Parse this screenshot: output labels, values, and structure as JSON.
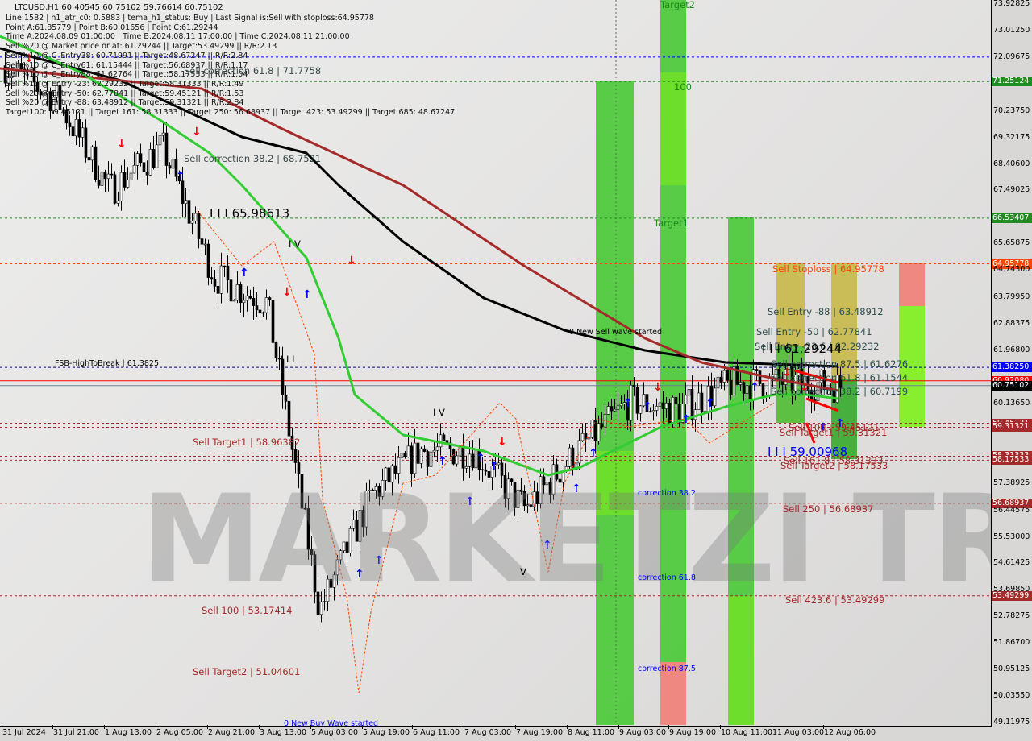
{
  "header": {
    "title": "LTCUSD,H1  60.40545 60.75102 59.76614 60.75102",
    "lines": [
      "Line:1582 | h1_atr_c0: 0.5883 | tema_h1_status: Buy | Last Signal is:Sell with stoploss:64.95778",
      "Point A:61.85779 | Point B:60.01656 | Point C:61.29244",
      "Time A:2024.08.09 01:00:00 | Time B:2024.08.11 17:00:00 | Time C:2024.08.11 21:00:00",
      "Sell %20 @ Market price or at: 61.29244 || Target:53.49299 || R/R:2.13",
      "Sell %10 @ C_Entry38: 60.71991 || Target:48.67247 || R/R:2.84",
      "Sell %10 @ C_Entry61: 61.15444 || Target:56.68937 || R/R:1.17",
      "Sell %10 @ C_Entry88: 61.62764 || Target:58.17533 || R/R:1.04",
      "Sell %10 @ Entry -23: 62.29232 || Target:58.31333 || R/R:1.49",
      "Sell %20 @ Entry -50: 62.77841 || Target:59.45121 || R/R:1.53",
      "Sell %20 @ Entry -88: 63.48912 || Target:59.31321 || R/R:2.84",
      "Target100: 59.45121 || Target 161: 58.31333 || Target 250: 56.68937 || Target 423: 53.49299 || Target 685: 48.67247"
    ]
  },
  "watermark": "MARKETZ TRADE",
  "annotations": [
    {
      "text": "Sell correction 61.8 | 71.7758",
      "color": "#3a4a4a"
    },
    {
      "text": "Sell correction 38.2 | 68.7521",
      "color": "#3a4a4a"
    },
    {
      "text": "I I I 65.98613",
      "color": "#000000"
    },
    {
      "text": "I V",
      "color": "#000000"
    },
    {
      "text": "I I I",
      "color": "#000000"
    },
    {
      "text": "FSB-HighToBreak | 61.3825",
      "color": "#000000"
    },
    {
      "text": "Sell Target1 | 58.96382",
      "color": "#a52a2a"
    },
    {
      "text": "I V",
      "color": "#000000"
    },
    {
      "text": "V",
      "color": "#000000"
    },
    {
      "text": "Sell 100 | 53.17414",
      "color": "#a52a2a"
    },
    {
      "text": "Sell Target2 | 51.04601",
      "color": "#a52a2a"
    },
    {
      "text": "0 New Buy Wave started",
      "color": "#0000ff"
    },
    {
      "text": "0 New Sell wave started",
      "color": "#000000"
    },
    {
      "text": "Target2",
      "color": "#1a8a1a"
    },
    {
      "text": "100",
      "color": "#1a8a1a"
    },
    {
      "text": "Target1",
      "color": "#1a8a1a"
    },
    {
      "text": "correction 38.2",
      "color": "#0000ff"
    },
    {
      "text": "correction 61.8",
      "color": "#0000ff"
    },
    {
      "text": "correction 87.5",
      "color": "#0000ff"
    },
    {
      "text": "Sell Stoploss | 64.95778",
      "color": "#ff4500"
    },
    {
      "text": "Sell Entry -88 | 63.48912",
      "color": "#2f4f4f"
    },
    {
      "text": "Sell Entry -50 | 62.77841",
      "color": "#2f4f4f"
    },
    {
      "text": "Sell Entry -23.6 | 62.29232",
      "color": "#2f4f4f"
    },
    {
      "text": "I I I 61.29244",
      "color": "#000000"
    },
    {
      "text": "Sell correction 87.5 | 61.6276",
      "color": "#2f4f4f"
    },
    {
      "text": "Sell correction 61.8 | 61.1544",
      "color": "#2f4f4f"
    },
    {
      "text": "Sell correction 38.2 | 60.7199",
      "color": "#2f4f4f"
    },
    {
      "text": "Sell 100 | 59.45121",
      "color": "#a52a2a"
    },
    {
      "text": "Sell Target1 | 59.31321",
      "color": "#a52a2a"
    },
    {
      "text": "I I I 59.00968",
      "color": "#0000ff"
    },
    {
      "text": "Sell 161.8 | 58.31333",
      "color": "#a52a2a"
    },
    {
      "text": "Sell Target2 | 58.17533",
      "color": "#a52a2a"
    },
    {
      "text": "Sell 250 | 56.68937",
      "color": "#a52a2a"
    },
    {
      "text": "Sell 423.6 | 53.49299",
      "color": "#a52a2a"
    }
  ],
  "chart_data": {
    "type": "candlestick",
    "symbol": "LTCUSD",
    "timeframe": "H1",
    "ohlc_last": {
      "open": 60.40545,
      "high": 60.75102,
      "low": 59.76614,
      "close": 60.75102
    },
    "ylim": [
      49.11975,
      73.92825
    ],
    "y_ticks": [
      "73.92825",
      "73.01250",
      "72.09675",
      "71.25124",
      "70.23750",
      "69.32175",
      "68.40600",
      "67.49025",
      "66.53407",
      "65.65875",
      "64.95778",
      "64.74300",
      "63.79950",
      "62.88375",
      "61.96800",
      "61.38250",
      "60.92080",
      "60.75102",
      "60.13650",
      "59.45121",
      "59.31321",
      "58.31333",
      "58.17533",
      "57.38925",
      "56.68937",
      "56.44575",
      "55.53000",
      "54.61425",
      "53.69850",
      "53.49299",
      "52.78275",
      "51.86700",
      "50.95125",
      "50.03550",
      "49.11975"
    ],
    "x_ticks": [
      "31 Jul 2024",
      "31 Jul 21:00",
      "1 Aug 13:00",
      "2 Aug 05:00",
      "2 Aug 21:00",
      "3 Aug 13:00",
      "5 Aug 03:00",
      "5 Aug 19:00",
      "6 Aug 11:00",
      "7 Aug 03:00",
      "7 Aug 19:00",
      "8 Aug 11:00",
      "9 Aug 03:00",
      "9 Aug 19:00",
      "10 Aug 11:00",
      "11 Aug 03:00",
      "12 Aug 06:00"
    ],
    "approx_close_path": [
      [
        "31 Jul 2024",
        71.8
      ],
      [
        "31 Jul 21:00",
        70.6
      ],
      [
        "1 Aug 13:00",
        67.5
      ],
      [
        "2 Aug 05:00",
        69.0
      ],
      [
        "2 Aug 21:00",
        64.5
      ],
      [
        "3 Aug 13:00",
        63.6
      ],
      [
        "5 Aug 03:00",
        53.0
      ],
      [
        "5 Aug 19:00",
        57.0
      ],
      [
        "6 Aug 11:00",
        58.5
      ],
      [
        "7 Aug 03:00",
        58.5
      ],
      [
        "7 Aug 19:00",
        56.5
      ],
      [
        "8 Aug 11:00",
        58.5
      ],
      [
        "9 Aug 03:00",
        60.2
      ],
      [
        "9 Aug 19:00",
        59.9
      ],
      [
        "10 Aug 11:00",
        60.8
      ],
      [
        "11 Aug 03:00",
        60.9
      ],
      [
        "12 Aug 06:00",
        60.75
      ]
    ],
    "levels": [
      {
        "value": 72.09675,
        "color": "#0000ff",
        "style": "dashed"
      },
      {
        "value": 71.25124,
        "color": "#228b22",
        "style": "dashed"
      },
      {
        "value": 66.53407,
        "color": "#228b22",
        "style": "dashed"
      },
      {
        "value": 64.95778,
        "color": "#ff4500",
        "style": "dashed"
      },
      {
        "value": 61.3825,
        "color": "#00008b",
        "style": "dashed"
      },
      {
        "value": 60.9208,
        "color": "#ff0000",
        "style": "solid"
      },
      {
        "value": 60.75102,
        "color": "#708090",
        "style": "solid"
      },
      {
        "value": 59.45121,
        "color": "#a52a2a",
        "style": "dashed"
      },
      {
        "value": 59.31321,
        "color": "#a52a2a",
        "style": "dashed"
      },
      {
        "value": 58.31333,
        "color": "#a52a2a",
        "style": "dashed"
      },
      {
        "value": 58.17533,
        "color": "#a52a2a",
        "style": "dashed"
      },
      {
        "value": 56.68937,
        "color": "#a52a2a",
        "style": "dashed"
      },
      {
        "value": 53.49299,
        "color": "#a52a2a",
        "style": "dashed"
      }
    ],
    "price_tags": [
      {
        "text": "71.25124",
        "color": "#228b22"
      },
      {
        "text": "66.53407",
        "color": "#228b22"
      },
      {
        "text": "64.95778",
        "color": "#ff4500"
      },
      {
        "text": "61.38250",
        "color": "#0000ff"
      },
      {
        "text": "60.92080",
        "color": "#ff0000"
      },
      {
        "text": "60.75102",
        "color": "#000000"
      },
      {
        "text": "59.45121",
        "color": "#a52a2a"
      },
      {
        "text": "59.31321",
        "color": "#a52a2a"
      },
      {
        "text": "58.31333",
        "color": "#a52a2a"
      },
      {
        "text": "58.17533",
        "color": "#a52a2a"
      },
      {
        "text": "56.68937",
        "color": "#a52a2a"
      },
      {
        "text": "53.49299",
        "color": "#a52a2a"
      }
    ],
    "colors": {
      "bull": "#00a000",
      "bear": "#c00000",
      "ma_fast": "#32cd32",
      "ma_mid": "#a52a2a",
      "ma_slow": "#000000"
    }
  }
}
